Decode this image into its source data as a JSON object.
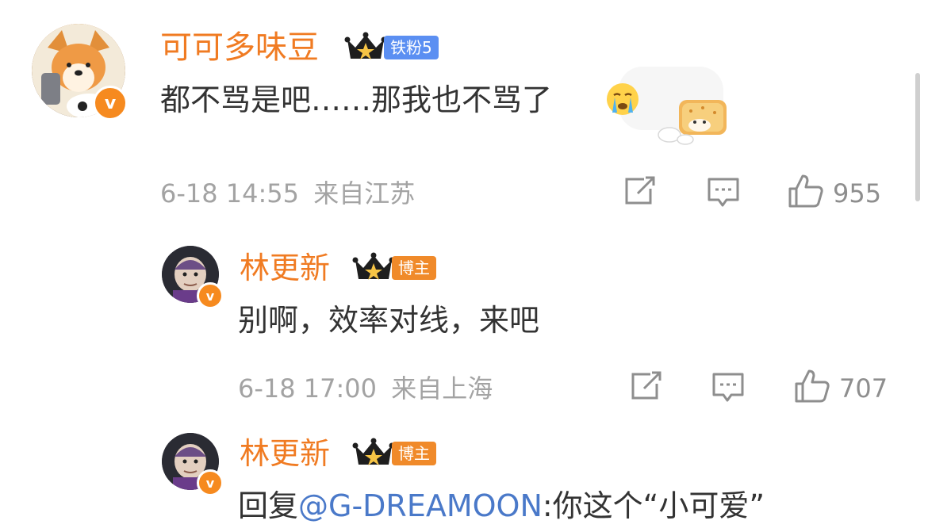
{
  "comments": [
    {
      "username": "可可多味豆",
      "fan_badge": "铁粉5",
      "text": "都不骂是吧……那我也不骂了",
      "time": "6-18 14:55",
      "location": "来自江苏",
      "likes": "955"
    },
    {
      "username": "林更新",
      "role_badge": "博主",
      "text": "别啊，效率对线，来吧",
      "time": "6-18 17:00",
      "location": "来自上海",
      "likes": "707"
    },
    {
      "username": "林更新",
      "role_badge": "博主",
      "reply_prefix": "回复",
      "mention": "@G-DREAMOON",
      "text": ":你这个“小可爱”"
    }
  ],
  "icons": {
    "verified": "verified-v-badge-icon",
    "crown": "crown-icon",
    "share": "share-icon",
    "comment": "comment-icon",
    "like": "thumbs-up-icon",
    "emoji": "crying-face-emoji",
    "sticker": "cookie-dog-sticker"
  },
  "colors": {
    "username": "#f07b22",
    "mention": "#4a79c9",
    "meta": "#a3a3a3",
    "tag_blue": "#5b8ff2",
    "tag_orange": "#f08a2a"
  }
}
